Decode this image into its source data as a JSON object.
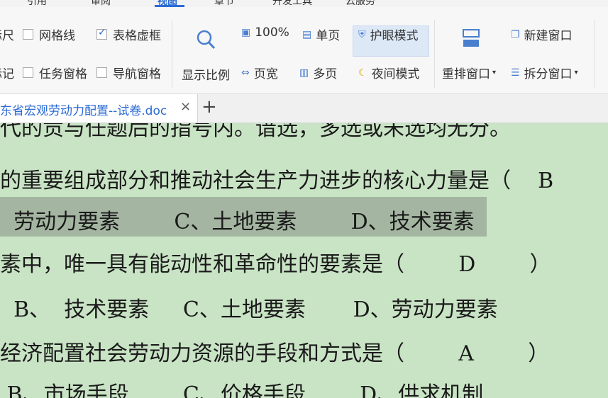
{
  "ribbon_tabs": [
    "引用",
    "审阅",
    "视图",
    "章节",
    "开发工具",
    "云服务"
  ],
  "ribbon": {
    "ruler": "标尺",
    "gridlines": "网格线",
    "table_gridlines": "表格虚框",
    "markup": "标记",
    "task_pane": "任务窗格",
    "nav_pane": "导航窗格",
    "zoom": "显示比例",
    "zoom_100": "100%",
    "single_page": "单页",
    "page_width": "页宽",
    "multi_page": "多页",
    "eye_mode": "护眼模式",
    "night_mode": "夜间模式",
    "arrange": "重排窗口",
    "new_window": "新建窗口",
    "split_window": "拆分窗口"
  },
  "document": {
    "tab_title": "东省宏观劳动力配置--试卷.doc",
    "close": "×",
    "new_tab": "+"
  },
  "lines": [
    "代的贡与任题后的指号内。谙选，多选或未选均无分。",
    "的重要组成部分和推动社会生产力进步的核心力量是（    B",
    "  劳动力要素        C、土地要素        D、技术要素",
    "素中，唯一具有能动性和革命性的要素是（        D        ）",
    "  B、  技术要素     C、土地要素       D、劳动力要素",
    "经济配置社会劳动力资源的手段和方式是（        A        ）",
    " B、市场手段        C、价格手段        D、供求机制"
  ],
  "colors": {
    "eye_protection_bg": "#c9e4c5",
    "selection": "#a4b6a1",
    "accent": "#2b6bd6"
  }
}
